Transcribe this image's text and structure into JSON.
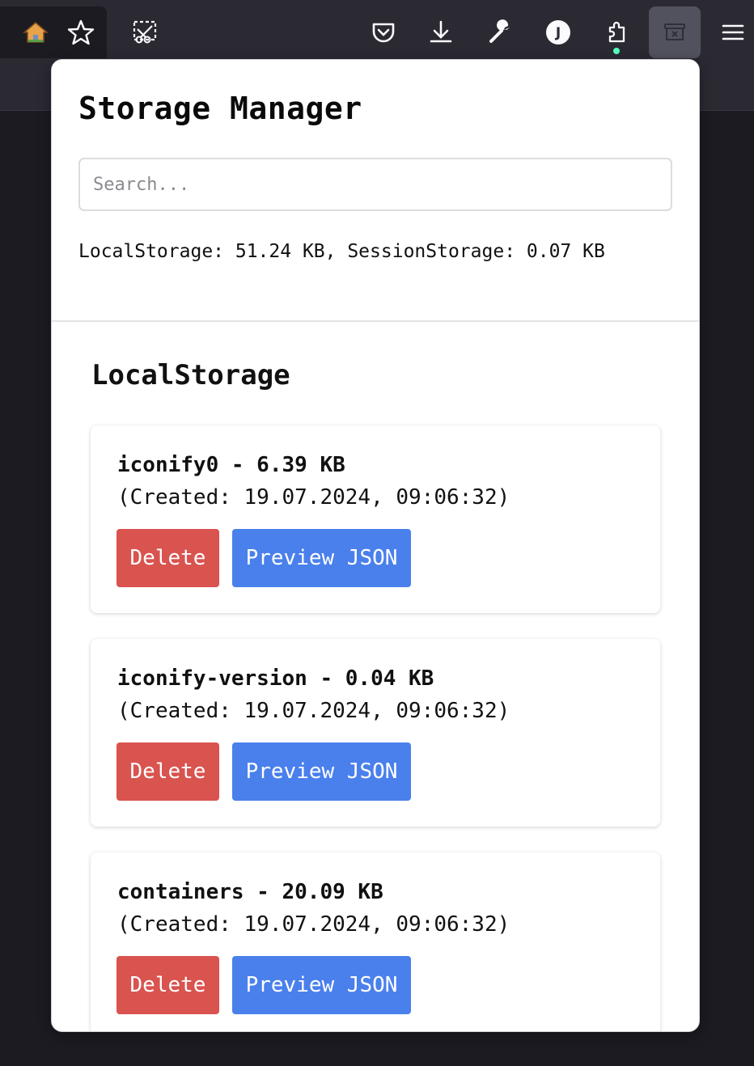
{
  "toolbar": {
    "icons": [
      "home-icon",
      "star-icon",
      "screenshot-icon",
      "pocket-icon",
      "download-icon",
      "wrench-icon",
      "profile-icon",
      "extensions-icon",
      "storage-manager-extension-icon",
      "menu-icon"
    ],
    "profile_initial": "J"
  },
  "popup": {
    "title": "Storage Manager",
    "search": {
      "placeholder": "Search...",
      "value": ""
    },
    "summary": "LocalStorage: 51.24 KB, SessionStorage: 0.07 KB"
  },
  "section": {
    "title": "LocalStorage",
    "items": [
      {
        "name": "iconify0 - 6.39 KB",
        "created": "(Created: 19.07.2024, 09:06:32)",
        "delete_label": "Delete",
        "preview_label": "Preview JSON"
      },
      {
        "name": "iconify-version - 0.04 KB",
        "created": "(Created: 19.07.2024, 09:06:32)",
        "delete_label": "Delete",
        "preview_label": "Preview JSON"
      },
      {
        "name": "containers - 20.09 KB",
        "created": "(Created: 19.07.2024, 09:06:32)",
        "delete_label": "Delete",
        "preview_label": "Preview JSON"
      }
    ]
  },
  "colors": {
    "delete": "#d9534f",
    "preview": "#4a80ec",
    "toolbar": "#2b2a33"
  }
}
